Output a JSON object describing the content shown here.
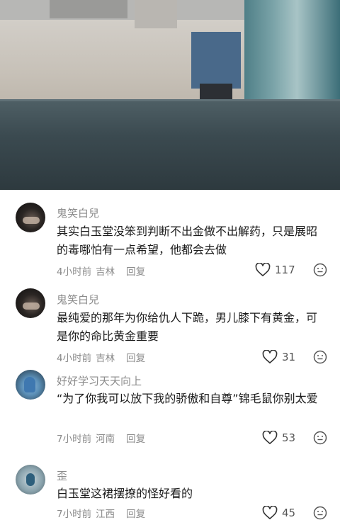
{
  "comments": [
    {
      "username": "鬼笑白兒",
      "text": "其实白玉堂没笨到判断不出金做不出解药，只是展昭的毒哪怕有一点希望，他都会去做",
      "time": "4小时前",
      "location": "吉林",
      "reply_label": "回复",
      "likes": "117"
    },
    {
      "username": "鬼笑白兒",
      "text": "最纯爱的那年为你给仇人下跪，男儿膝下有黄金，可是你的命比黄金重要",
      "time": "4小时前",
      "location": "吉林",
      "reply_label": "回复",
      "likes": "31"
    },
    {
      "username": "好好学习天天向上",
      "text": "“为了你我可以放下我的骄傲和自尊”锦毛鼠你别太爱",
      "time": "7小时前",
      "location": "河南",
      "reply_label": "回复",
      "likes": "53"
    },
    {
      "username": "歪",
      "text": "白玉堂这裙摆撩的怪好看的",
      "time": "7小时前",
      "location": "江西",
      "reply_label": "回复",
      "likes": "45"
    }
  ],
  "icons": {
    "like": "heart-outline-icon",
    "emoji": "emoji-face-icon"
  },
  "colors": {
    "secondary_text": "#8b8b8b",
    "primary_text": "#1a1a1a"
  }
}
